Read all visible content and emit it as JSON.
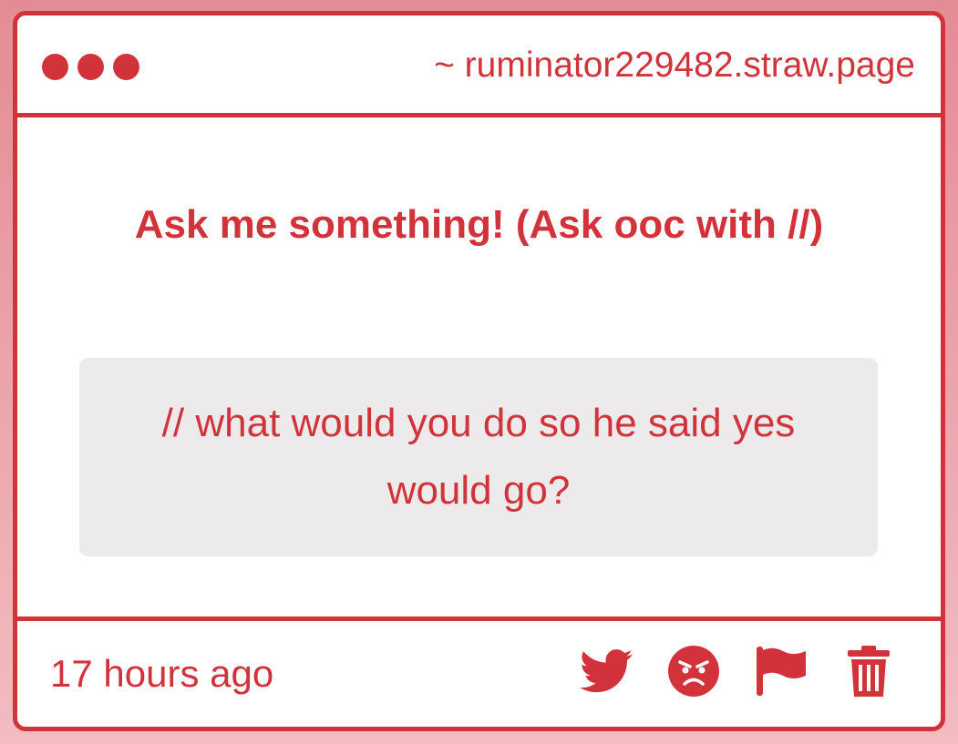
{
  "window": {
    "url": "~ ruminator229482.straw.page"
  },
  "content": {
    "prompt": "Ask me something! (Ask ooc with //)",
    "question": "// what would you do so he said yes would go?"
  },
  "footer": {
    "timestamp": "17 hours ago",
    "actions": [
      {
        "icon": "twitter-icon"
      },
      {
        "icon": "angry-face-icon"
      },
      {
        "icon": "flag-icon"
      },
      {
        "icon": "trash-icon"
      }
    ]
  },
  "colors": {
    "accent": "#d2333b",
    "question_bg": "#eceaeb",
    "page_bg": "#eca3aa"
  }
}
